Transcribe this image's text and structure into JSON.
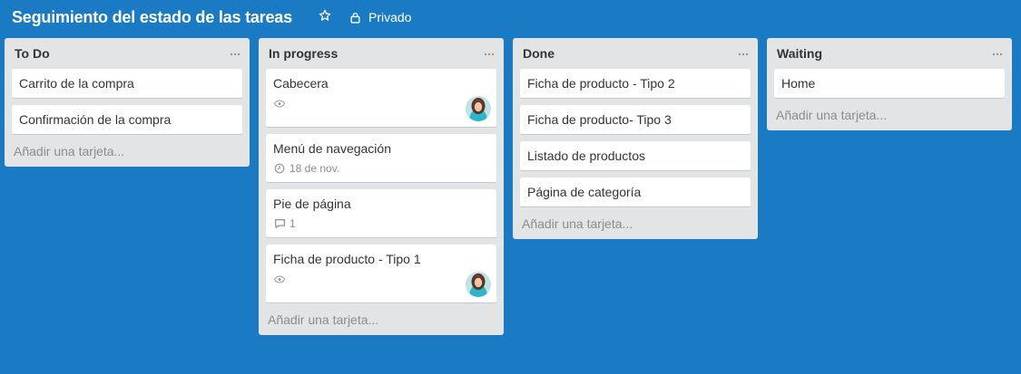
{
  "board": {
    "title": "Seguimiento del estado de las tareas",
    "privacy_label": "Privado",
    "background_color": "#1a7bc4"
  },
  "lists": [
    {
      "title": "To Do",
      "add_card_label": "Añadir una tarjeta...",
      "cards": [
        {
          "title": "Carrito de la compra"
        },
        {
          "title": "Confirmación de la compra"
        }
      ]
    },
    {
      "title": "In progress",
      "add_card_label": "Añadir una tarjeta...",
      "cards": [
        {
          "title": "Cabecera",
          "badge_icon": "eye-icon",
          "avatar": true
        },
        {
          "title": "Menú de navegación",
          "badge_icon": "clock-icon",
          "badge_text": "18 de nov."
        },
        {
          "title": "Pie de página",
          "badge_icon": "comment-icon",
          "badge_text": "1"
        },
        {
          "title": "Ficha de producto - Tipo 1",
          "badge_icon": "eye-icon",
          "avatar": true
        }
      ]
    },
    {
      "title": "Done",
      "add_card_label": "Añadir una tarjeta...",
      "cards": [
        {
          "title": "Ficha de producto - Tipo 2"
        },
        {
          "title": "Ficha de producto- Tipo 3"
        },
        {
          "title": "Listado de productos"
        },
        {
          "title": "Página de categoría"
        }
      ]
    },
    {
      "title": "Waiting",
      "add_card_label": "Añadir una tarjeta...",
      "cards": [
        {
          "title": "Home"
        }
      ]
    }
  ]
}
